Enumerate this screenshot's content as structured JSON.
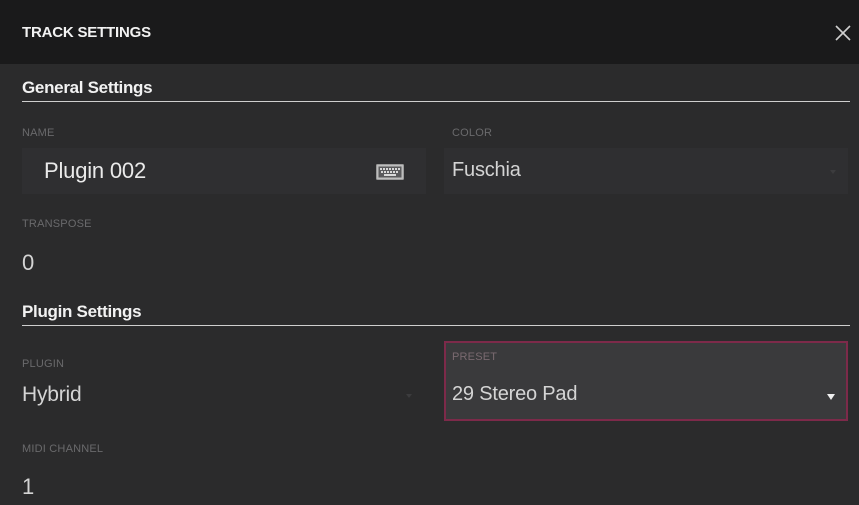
{
  "dialog": {
    "title": "TRACK SETTINGS",
    "close_icon": "close-icon"
  },
  "general": {
    "heading": "General Settings",
    "name": {
      "label": "NAME",
      "value": "Plugin 002",
      "icon": "keyboard-icon"
    },
    "color": {
      "label": "COLOR",
      "value": "Fuschia"
    },
    "transpose": {
      "label": "TRANSPOSE",
      "value": "0"
    }
  },
  "plugin_settings": {
    "heading": "Plugin Settings",
    "plugin": {
      "label": "PLUGIN",
      "value": "Hybrid"
    },
    "preset": {
      "label": "PRESET",
      "value": "29 Stereo Pad",
      "icon": "dropdown-caret-icon"
    },
    "midi_channel": {
      "label": "MIDI CHANNEL",
      "value": "1"
    }
  },
  "colors": {
    "accent_border": "#7d2a4a",
    "titlebar_bg": "#1a1a1b",
    "panel_bg": "#2b2b2c"
  }
}
